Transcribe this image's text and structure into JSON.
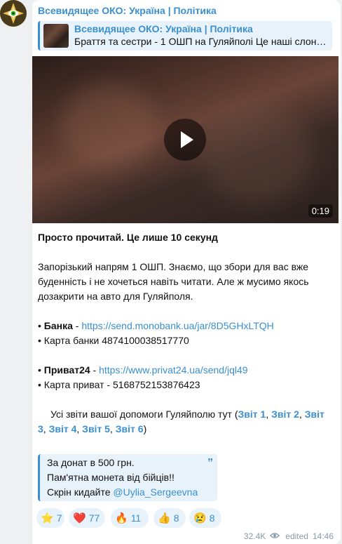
{
  "channel": {
    "name": "Всевидящее ОКО: Україна | Політика"
  },
  "reply": {
    "title": "Всевидящее ОКО: Україна | Політика",
    "text": "Браття та сестри - 1 ОШП на Гуляйполі Це наші слони …"
  },
  "video": {
    "duration": "0:19",
    "icon": "play-icon"
  },
  "message": {
    "headline": "Просто прочитай. Це лише 10 секунд",
    "p1_l1": "Запорізький напрям 1 ОШП. Знаємо, що збори для вас вже",
    "p1_l2": "буденність і не хочеться навіть читати. Але ж мусимо якось",
    "p1_l3": "дозакрити на авто для Гуляйполя.",
    "bank_bullet": "• ",
    "bank_label": "Банка",
    "bank_sep": " - ",
    "bank_link": "https://send.monobank.ua/jar/8D5GHxLTQH",
    "bank_card": "• Карта банки 4874100038517770",
    "privat_bullet": "• ",
    "privat_label": "Приват24",
    "privat_sep": " - ",
    "privat_link": "https://www.privat24.ua/send/jql49",
    "privat_card": "• Карта приват - 5168752153876423",
    "reports_text": "Усі звіти вашої допомоги Гуляйполю тут (",
    "report1": "Звіт 1",
    "report2": "Звіт 2",
    "report3_a": "Звіт",
    "report3_b": "3",
    "report4": "Звіт 4",
    "report5": "Звіт 5",
    "report6": "Звіт 6",
    "comma": ", ",
    "close_paren": ")"
  },
  "quote": {
    "line1": "За донат в 500 грн.",
    "line2": "Пам'ятна монета від бійців!!",
    "line3_text": "Скрін кидайте ",
    "line3_link": "@Uylia_Sergeevna",
    "icon": "quote-icon"
  },
  "reactions": [
    {
      "emoji": "⭐",
      "count": "7",
      "icon": "star-icon"
    },
    {
      "emoji": "❤️",
      "count": "77",
      "icon": "heart-icon"
    },
    {
      "emoji": "🔥",
      "count": "11",
      "icon": "fire-icon"
    },
    {
      "emoji": "👍",
      "count": "8",
      "icon": "thumbs-up-icon"
    },
    {
      "emoji": "😢",
      "count": "8",
      "icon": "crying-face-icon"
    }
  ],
  "meta": {
    "views": "32.4K",
    "edited": "edited",
    "time": "14:46",
    "views_icon": "eye-icon"
  },
  "colors": {
    "accent": "#3a8fd0",
    "quote_bg": "#e8f2fb",
    "page_bg": "#eef0f2"
  }
}
